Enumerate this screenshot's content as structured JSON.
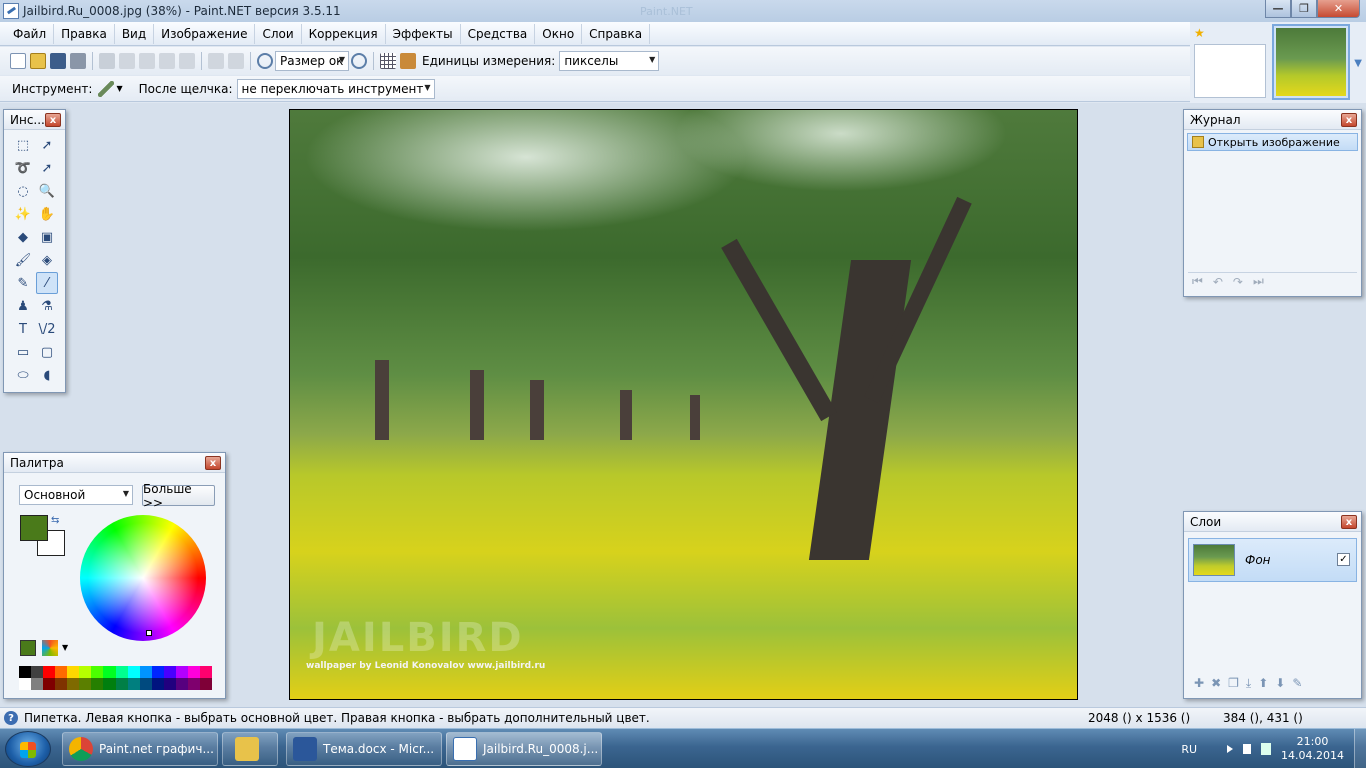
{
  "window": {
    "title": "Jailbird.Ru_0008.jpg (38%) - Paint.NET версия 3.5.11",
    "minimize": "—",
    "maximize": "❐",
    "close": "✕"
  },
  "menu": [
    "Файл",
    "Правка",
    "Вид",
    "Изображение",
    "Слои",
    "Коррекция",
    "Эффекты",
    "Средства",
    "Окно",
    "Справка"
  ],
  "toolbar": {
    "zoom_value": "Размер ок",
    "units_label": "Единицы измерения:",
    "units_value": "пикселы",
    "tool_label": "Инструмент:",
    "after_click_label": "После щелчка:",
    "after_click_value": "не переключать инструмент"
  },
  "tools_panel": {
    "title": "Инс...",
    "close": "x",
    "tools": [
      {
        "name": "rect-select",
        "glyph": "⬚"
      },
      {
        "name": "move-selection",
        "glyph": "➚"
      },
      {
        "name": "lasso-select",
        "glyph": "➰"
      },
      {
        "name": "move-selected",
        "glyph": "➚"
      },
      {
        "name": "ellipse-select",
        "glyph": "◌"
      },
      {
        "name": "zoom",
        "glyph": "🔍"
      },
      {
        "name": "magic-wand",
        "glyph": "✨"
      },
      {
        "name": "pan",
        "glyph": "✋"
      },
      {
        "name": "paint-bucket",
        "glyph": "◆"
      },
      {
        "name": "gradient",
        "glyph": "▣"
      },
      {
        "name": "paintbrush",
        "glyph": "🖌"
      },
      {
        "name": "eraser",
        "glyph": "◈"
      },
      {
        "name": "pencil",
        "glyph": "✎"
      },
      {
        "name": "color-picker",
        "glyph": "⁄",
        "selected": true
      },
      {
        "name": "clone-stamp",
        "glyph": "♟"
      },
      {
        "name": "recolor",
        "glyph": "⚗"
      },
      {
        "name": "text",
        "glyph": "T"
      },
      {
        "name": "line-curve",
        "glyph": "\\/2"
      },
      {
        "name": "rectangle",
        "glyph": "▭"
      },
      {
        "name": "rounded-rectangle",
        "glyph": "▢"
      },
      {
        "name": "ellipse",
        "glyph": "⬭"
      },
      {
        "name": "freeform-shape",
        "glyph": "◖"
      }
    ]
  },
  "history_panel": {
    "title": "Журнал",
    "close": "x",
    "items": [
      "Открыть изображение"
    ],
    "controls": [
      "⏮",
      "↶",
      "↷",
      "⏭"
    ]
  },
  "palette_panel": {
    "title": "Палитра",
    "close": "x",
    "mode": "Основной",
    "more_button": "Больше >>",
    "primary_color": "#4a7a1a",
    "secondary_color": "#ffffff",
    "swatches_top": [
      "#000000",
      "#404040",
      "#ff0000",
      "#ff6a00",
      "#ffd800",
      "#b6ff00",
      "#4cff00",
      "#00ff21",
      "#00ff90",
      "#00ffff",
      "#0094ff",
      "#0026ff",
      "#4800ff",
      "#b200ff",
      "#ff00dc",
      "#ff006e"
    ],
    "swatches_bottom": [
      "#ffffff",
      "#808080",
      "#7f0000",
      "#7f3300",
      "#7f6a00",
      "#5b7f00",
      "#267f00",
      "#007f0e",
      "#007f46",
      "#007f7f",
      "#004a7f",
      "#00137f",
      "#21007f",
      "#57007f",
      "#7f006e",
      "#7f0037"
    ]
  },
  "layers_panel": {
    "title": "Слои",
    "close": "x",
    "layers": [
      {
        "name": "Фон",
        "visible": true
      }
    ],
    "check_mark": "✓",
    "controls": [
      "✚",
      "✖",
      "❐",
      "⤓",
      "⬆",
      "⬇",
      "✎"
    ]
  },
  "canvas": {
    "watermark_big": "JAILBIRD",
    "watermark": "wallpaper by Leonid Konovalov  www.jailbird.ru"
  },
  "status": {
    "help_icon": "?",
    "message": "Пипетка. Левая кнопка - выбрать основной цвет. Правая кнопка - выбрать дополнительный цвет.",
    "image_size": "2048 () x 1536 ()",
    "cursor_pos": "384 (), 431 ()"
  },
  "taskbar": {
    "items": [
      {
        "label": "Paint.net графич...",
        "icon_color": "#e8a030"
      },
      {
        "label": "",
        "icon_color": "#e8c24a"
      },
      {
        "label": "Тема.docx - Micr...",
        "icon_color": "#2b579a"
      },
      {
        "label": "Jailbird.Ru_0008.j...",
        "icon_color": "#3a6fb0"
      }
    ],
    "lang": "RU",
    "time": "21:00",
    "date": "14.04.2014"
  },
  "colors": {
    "accent": "#3a6fb0",
    "selection": "#c3dcf6"
  }
}
